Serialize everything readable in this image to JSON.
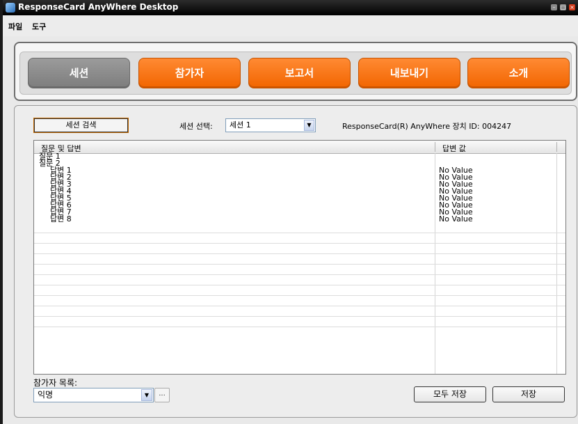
{
  "window": {
    "title": "ResponseCard AnyWhere Desktop"
  },
  "menu": {
    "items": [
      "파일",
      "도구"
    ]
  },
  "nav": {
    "tabs": [
      {
        "label": "세션",
        "active": true
      },
      {
        "label": "참가자",
        "active": false
      },
      {
        "label": "보고서",
        "active": false
      },
      {
        "label": "내보내기",
        "active": false
      },
      {
        "label": "소개",
        "active": false
      }
    ]
  },
  "session": {
    "search_label": "세션 검색",
    "select_label": "세션 선택:",
    "selected": "세션 1",
    "device_id": "ResponseCard(R) AnyWhere 장치 ID: 004247"
  },
  "table": {
    "headers": [
      "질문 및 답변",
      "답변 값"
    ],
    "rows": [
      {
        "text": "질문 1",
        "value": "",
        "indent": 0
      },
      {
        "text": "질문 2",
        "value": "",
        "indent": 0
      },
      {
        "text": "답변 1",
        "value": "No Value",
        "indent": 1
      },
      {
        "text": "답변 2",
        "value": "No Value",
        "indent": 1
      },
      {
        "text": "답변 3",
        "value": "No Value",
        "indent": 1
      },
      {
        "text": "답변 4",
        "value": "No Value",
        "indent": 1
      },
      {
        "text": "답변 5",
        "value": "No Value",
        "indent": 1
      },
      {
        "text": "답변 6",
        "value": "No Value",
        "indent": 1
      },
      {
        "text": "답변 7",
        "value": "No Value",
        "indent": 1
      },
      {
        "text": "답변 8",
        "value": "No Value",
        "indent": 1
      }
    ]
  },
  "participants": {
    "label": "참가자 목록:",
    "selected": "익명",
    "more": "..."
  },
  "actions": {
    "save_all": "모두 저장",
    "save": "저장"
  },
  "colors": {
    "accent": "#f26500",
    "active_tab": "#8a8a8a"
  },
  "icons": {
    "app": "app-icon",
    "dropdown": "chevron-down-icon"
  }
}
